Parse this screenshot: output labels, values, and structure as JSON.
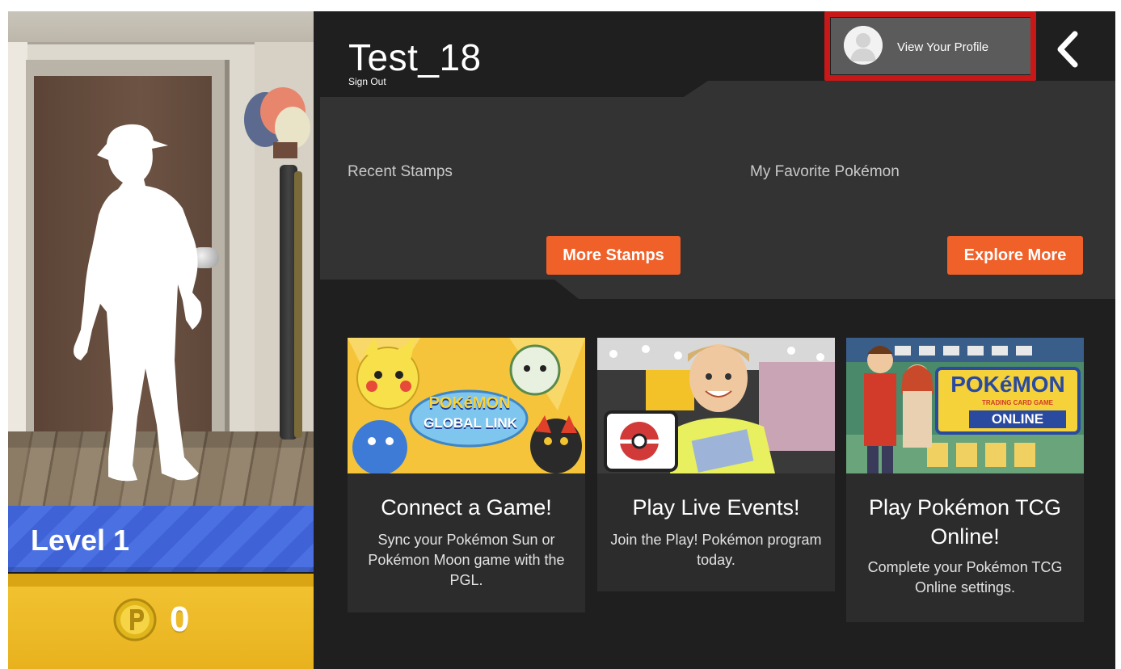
{
  "profile": {
    "username": "Test_18",
    "sign_out_label": "Sign Out",
    "view_profile_label": "View Your Profile",
    "level_label": "Level 1",
    "coin_count": "0"
  },
  "stamps": {
    "recent_label": "Recent Stamps",
    "favorite_label": "My Favorite Pokémon",
    "more_stamps_label": "More Stamps",
    "explore_more_label": "Explore More"
  },
  "cards": [
    {
      "title": "Connect a Game!",
      "description": "Sync your Pokémon Sun or Pokémon Moon game with the PGL.",
      "image_text_1": "POKéMON",
      "image_text_2": "GLOBAL LINK"
    },
    {
      "title": "Play Live Events!",
      "description": "Join the Play! Pokémon program today."
    },
    {
      "title": "Play Pokémon TCG Online!",
      "description": "Complete your Pokémon TCG Online settings.",
      "image_text_1": "POKéMON",
      "image_text_2": "TRADING CARD GAME",
      "image_text_3": "ONLINE"
    }
  ],
  "colors": {
    "accent_orange": "#f0612a",
    "highlight_red": "#c81818",
    "level_blue": "#4a70e2",
    "coin_yellow": "#f3c434"
  }
}
